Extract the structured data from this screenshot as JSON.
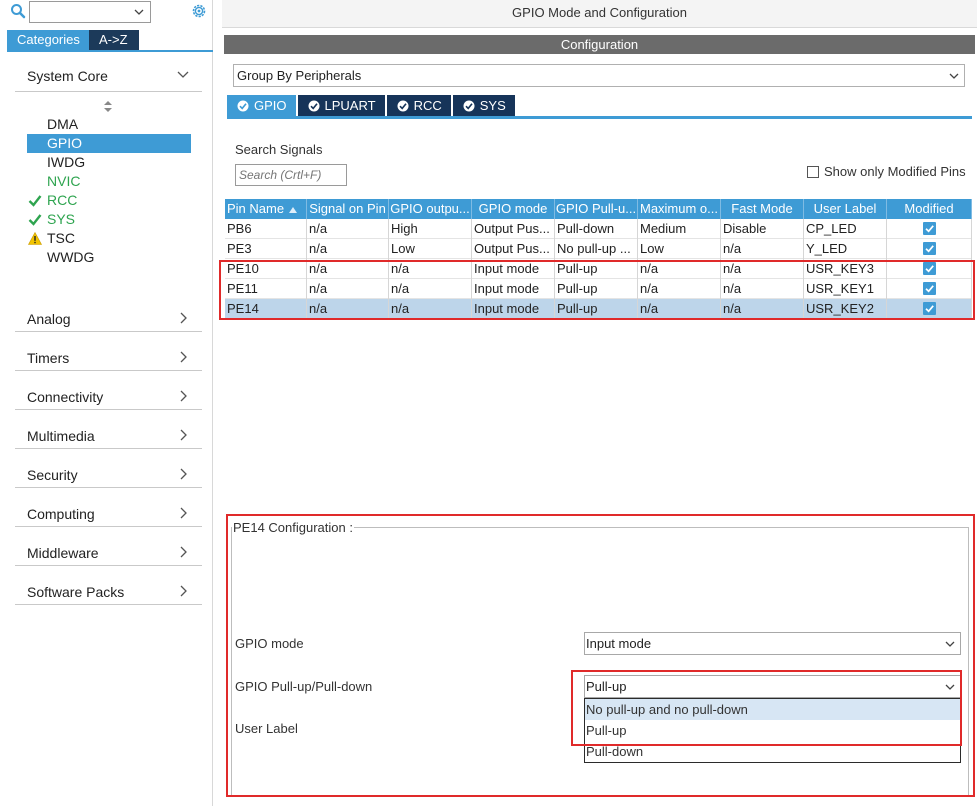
{
  "left_panel": {
    "search": {
      "value": ""
    },
    "tabs": [
      {
        "label": "Categories",
        "active": true
      },
      {
        "label": "A->Z",
        "active": false
      }
    ],
    "system_core": {
      "title": "System Core",
      "items": [
        {
          "label": "DMA",
          "state": "normal"
        },
        {
          "label": "GPIO",
          "state": "selected"
        },
        {
          "label": "IWDG",
          "state": "normal"
        },
        {
          "label": "NVIC",
          "state": "green"
        },
        {
          "label": "RCC",
          "state": "checked"
        },
        {
          "label": "SYS",
          "state": "checked"
        },
        {
          "label": "TSC",
          "state": "warning"
        },
        {
          "label": "WWDG",
          "state": "normal"
        }
      ]
    },
    "categories": [
      "Analog",
      "Timers",
      "Connectivity",
      "Multimedia",
      "Security",
      "Computing",
      "Middleware",
      "Software Packs"
    ]
  },
  "main": {
    "title": "GPIO Mode and Configuration",
    "config_header": "Configuration",
    "group_select": {
      "value": "Group By Peripherals"
    },
    "peripheral_tabs": [
      {
        "label": "GPIO",
        "active": true
      },
      {
        "label": "LPUART",
        "active": false
      },
      {
        "label": "RCC",
        "active": false
      },
      {
        "label": "SYS",
        "active": false
      }
    ],
    "search_signals_label": "Search Signals",
    "search_placeholder": "Search (Crtl+F)",
    "show_modified_label": "Show only Modified Pins",
    "table": {
      "columns": [
        "Pin Name",
        "Signal on Pin",
        "GPIO outpu...",
        "GPIO mode",
        "GPIO Pull-u...",
        "Maximum o...",
        "Fast Mode",
        "User Label",
        "Modified"
      ],
      "rows": [
        {
          "cells": [
            "PB6",
            "n/a",
            "High",
            "Output Pus...",
            "Pull-down",
            "Medium",
            "Disable",
            "CP_LED"
          ],
          "modified": true,
          "selected": false
        },
        {
          "cells": [
            "PE3",
            "n/a",
            "Low",
            "Output Pus...",
            "No pull-up ...",
            "Low",
            "n/a",
            "Y_LED"
          ],
          "modified": true,
          "selected": false
        },
        {
          "cells": [
            "PE10",
            "n/a",
            "n/a",
            "Input mode",
            "Pull-up",
            "n/a",
            "n/a",
            "USR_KEY3"
          ],
          "modified": true,
          "selected": false
        },
        {
          "cells": [
            "PE11",
            "n/a",
            "n/a",
            "Input mode",
            "Pull-up",
            "n/a",
            "n/a",
            "USR_KEY1"
          ],
          "modified": true,
          "selected": false
        },
        {
          "cells": [
            "PE14",
            "n/a",
            "n/a",
            "Input mode",
            "Pull-up",
            "n/a",
            "n/a",
            "USR_KEY2"
          ],
          "modified": true,
          "selected": true
        }
      ]
    },
    "pin_config": {
      "title": "PE14 Configuration :",
      "gpio_mode_label": "GPIO mode",
      "gpio_mode_value": "Input mode",
      "pull_label": "GPIO Pull-up/Pull-down",
      "pull_value": "Pull-up",
      "user_label_label": "User Label",
      "pull_options": [
        "No pull-up and no pull-down",
        "Pull-up",
        "Pull-down"
      ]
    }
  },
  "colors": {
    "accent": "#3e9bd5",
    "dark_tab": "#163459",
    "annotation": "#e02a2a",
    "ok_green": "#2ea44f",
    "warning": "#f2c400"
  }
}
